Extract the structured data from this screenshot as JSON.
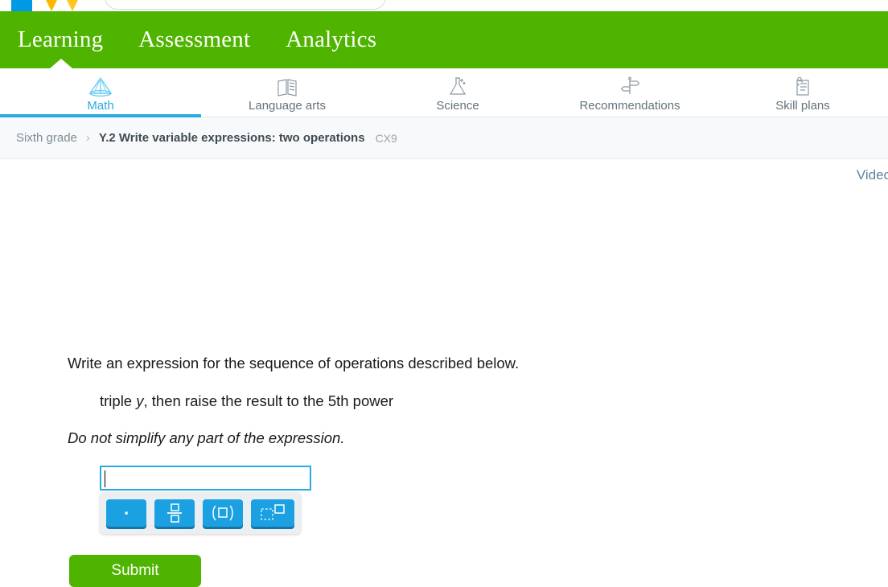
{
  "topbar": {
    "logo_name": "ixl-logo",
    "search_placeholder": "",
    "search_value": ""
  },
  "primary_nav": {
    "items": [
      {
        "label": "Learning",
        "active": true
      },
      {
        "label": "Assessment",
        "active": false
      },
      {
        "label": "Analytics",
        "active": false
      }
    ],
    "bar_color": "#4fb400"
  },
  "subject_nav": {
    "active_color": "#29abe2",
    "items": [
      {
        "label": "Math",
        "icon": "pyramid-icon",
        "active": true
      },
      {
        "label": "Language arts",
        "icon": "book-icon",
        "active": false
      },
      {
        "label": "Science",
        "icon": "flask-icon",
        "active": false
      },
      {
        "label": "Recommendations",
        "icon": "signpost-icon",
        "active": false
      },
      {
        "label": "Skill plans",
        "icon": "clipboard-icon",
        "active": false
      }
    ]
  },
  "breadcrumb": {
    "grade": "Sixth grade",
    "separator": "›",
    "skill": "Y.2 Write variable expressions: two operations",
    "code": "CX9"
  },
  "content": {
    "video_link": "Video",
    "question_line1": "Write an expression for the sequence of operations described below.",
    "question_line2_prefix": "triple ",
    "question_line2_variable": "y",
    "question_line2_suffix": ", then raise the result to the 5th power",
    "note": "Do not simplify any part of the expression.",
    "answer_value": "",
    "submit_label": "Submit"
  },
  "keypad": {
    "buttons": [
      {
        "name": "multiplication-dot-key",
        "aria": "multiplication dot"
      },
      {
        "name": "fraction-key",
        "aria": "fraction"
      },
      {
        "name": "parentheses-key",
        "aria": "parentheses"
      },
      {
        "name": "exponent-key",
        "aria": "exponent"
      }
    ],
    "key_color": "#1ba1e2"
  }
}
